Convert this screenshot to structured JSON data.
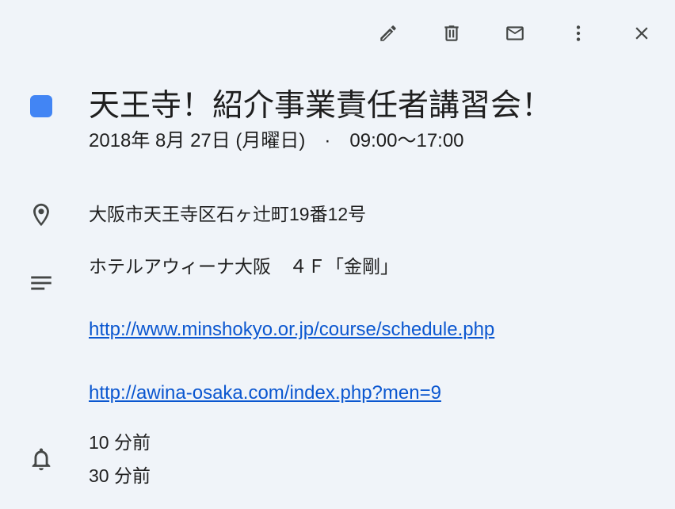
{
  "toolbar": {
    "icons": [
      "pencil-icon",
      "trash-icon",
      "mail-icon",
      "more-vert-icon",
      "close-icon"
    ]
  },
  "event": {
    "color": "#4285f4",
    "title": "天王寺！紹介事業責任者講習会！",
    "datetime": "2018年 8月 27日 (月曜日)　·　09:00〜17:00"
  },
  "location": {
    "icon": "location-pin-icon",
    "address": "大阪市天王寺区石ヶ辻町19番12号"
  },
  "description": {
    "icon": "notes-icon",
    "venue": "ホテルアウィーナ大阪　４Ｆ「金剛」",
    "link1": "http://www.minshokyo.or.jp/course/schedule.php",
    "link2": "http://awina-osaka.com/index.php?men=9"
  },
  "reminders": {
    "icon": "bell-icon",
    "items": [
      "10 分前",
      "30 分前"
    ]
  }
}
